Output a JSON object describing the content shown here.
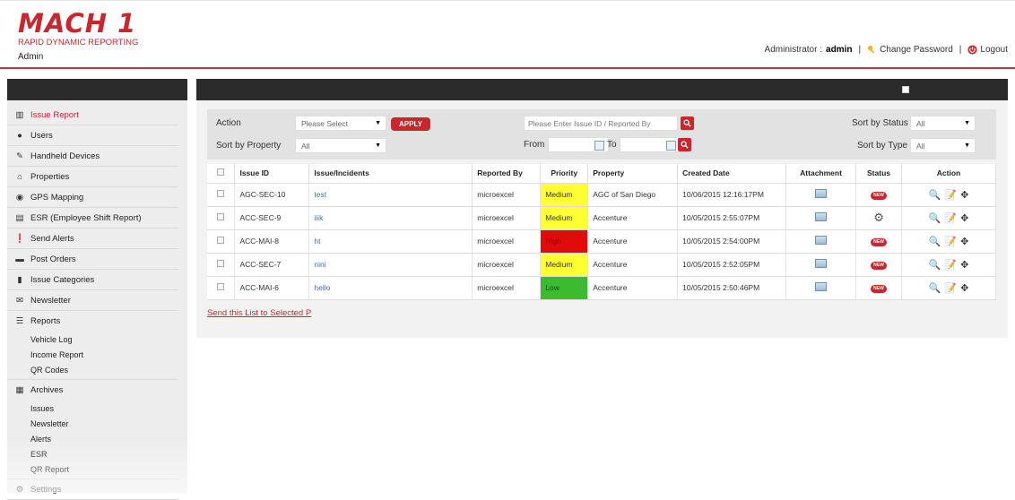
{
  "header": {
    "logo_title": "MACH 1",
    "logo_subtitle": "RAPID DYNAMIC REPORTING",
    "user_label": "Admin",
    "admin_prefix": "Administrator :",
    "admin_name": "admin",
    "change_password": "Change Password",
    "logout": "Logout"
  },
  "sidebar": {
    "items": [
      {
        "label": "Issue Report",
        "icon": "building-icon",
        "active": true
      },
      {
        "label": "Users",
        "icon": "user-icon"
      },
      {
        "label": "Handheld Devices",
        "icon": "edit-icon"
      },
      {
        "label": "Properties",
        "icon": "home-icon"
      },
      {
        "label": "GPS Mapping",
        "icon": "map-pin-icon"
      },
      {
        "label": "ESR (Employee Shift Report)",
        "icon": "id-card-icon"
      },
      {
        "label": "Send Alerts",
        "icon": "alert-icon"
      },
      {
        "label": "Post Orders",
        "icon": "car-icon"
      },
      {
        "label": "Issue Categories",
        "icon": "file-icon"
      },
      {
        "label": "Newsletter",
        "icon": "envelope-icon"
      }
    ],
    "reports": {
      "label": "Reports",
      "subs": [
        "Vehicle Log",
        "Income Report",
        "QR Codes"
      ]
    },
    "archives": {
      "label": "Archives",
      "subs": [
        "Issues",
        "Newsletter",
        "Alerts",
        "ESR",
        "QR Report"
      ]
    },
    "settings": "Settings"
  },
  "filters": {
    "action_label": "Action",
    "action_select": "Please Select",
    "apply": "APPLY",
    "sort_property_label": "Sort by Property",
    "sort_property_value": "All",
    "search_placeholder": "Please Enter Issue ID / Reported By",
    "from_label": "From",
    "to_label": "To",
    "sort_status_label": "Sort by Status",
    "sort_status_value": "All",
    "sort_type_label": "Sort by Type",
    "sort_type_value": "All"
  },
  "table": {
    "headers": [
      "Issue ID",
      "Issue/Incidents",
      "Reported By",
      "Priority",
      "Property",
      "Created Date",
      "Attachment",
      "Status",
      "Action"
    ],
    "rows": [
      {
        "id": "AGC-SEC-10",
        "issue": "test",
        "reported_by": "microexcel",
        "priority": "Medium",
        "property": "AGC of San Diego",
        "created": "10/06/2015 12:16:17PM",
        "status": "new"
      },
      {
        "id": "ACC-SEC-9",
        "issue": "iiik",
        "reported_by": "microexcel",
        "priority": "Medium",
        "property": "Accenture",
        "created": "10/05/2015 2:55:07PM",
        "status": "in-progress"
      },
      {
        "id": "ACC-MAI-8",
        "issue": "ht",
        "reported_by": "microexcel",
        "priority": "High",
        "property": "Accenture",
        "created": "10/05/2015 2:54:00PM",
        "status": "new"
      },
      {
        "id": "ACC-SEC-7",
        "issue": "nini",
        "reported_by": "microexcel",
        "priority": "Medium",
        "property": "Accenture",
        "created": "10/05/2015 2:52:05PM",
        "status": "new"
      },
      {
        "id": "ACC-MAI-6",
        "issue": "hello",
        "reported_by": "microexcel",
        "priority": "Low",
        "property": "Accenture",
        "created": "10/05/2015 2:50:46PM",
        "status": "new"
      }
    ],
    "new_badge": "NEW"
  },
  "send_link": "Send this List to Selected P",
  "colors": {
    "brand_red": "#c9262d",
    "priority_medium": "#ffff33",
    "priority_high": "#e10b0b",
    "priority_low": "#3bbb2f"
  }
}
